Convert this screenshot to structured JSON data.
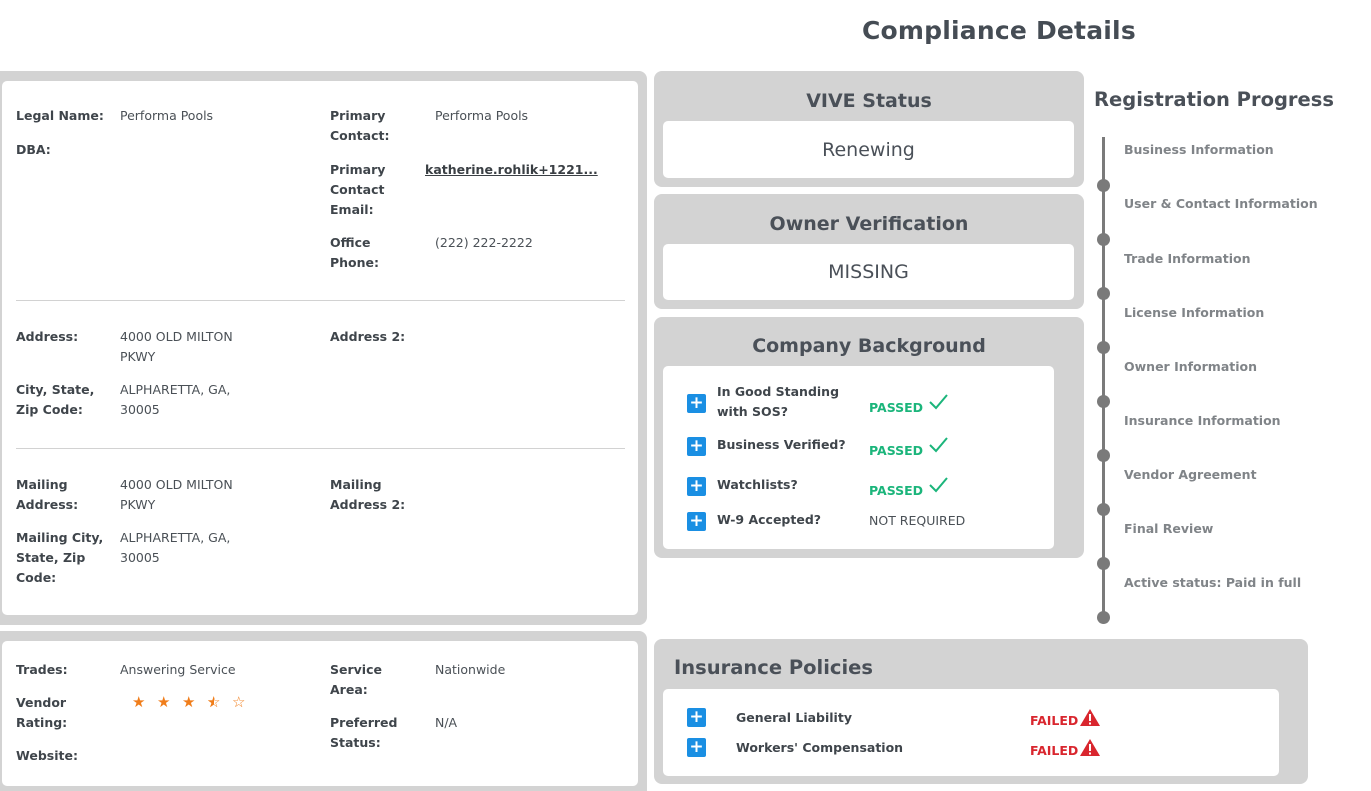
{
  "page_title": "Compliance Details",
  "company": {
    "legal_name_label": "Legal Name:",
    "legal_name": "Performa Pools",
    "dba_label": "DBA:",
    "dba": "",
    "primary_contact_label": "Primary Contact:",
    "primary_contact": "Performa Pools",
    "primary_email_label": "Primary Contact Email:",
    "primary_email": "katherine.rohlik+1221...",
    "office_phone_label": "Office Phone:",
    "office_phone": "(222) 222-2222",
    "address_label": "Address:",
    "address": "4000 OLD MILTON PKWY",
    "address2_label": "Address 2:",
    "address2": "",
    "city_label": "City, State, Zip Code:",
    "city": "ALPHARETTA, GA, 30005",
    "mailing_address_label": "Mailing Address:",
    "mailing_address": "4000 OLD MILTON PKWY",
    "mailing_address2_label": "Mailing Address 2:",
    "mailing_address2": "",
    "mailing_city_label": "Mailing City, State, Zip Code:",
    "mailing_city": "ALPHARETTA, GA, 30005"
  },
  "vendor": {
    "trades_label": "Trades:",
    "trades": "Answering Service",
    "service_area_label": "Service Area:",
    "service_area": "Nationwide",
    "rating_label": "Vendor Rating:",
    "rating": 3.5,
    "rating_max": 5,
    "preferred_label": "Preferred Status:",
    "preferred": "N/A",
    "website_label": "Website:",
    "website": ""
  },
  "vive_status": {
    "title": "VIVE Status",
    "value": "Renewing"
  },
  "owner_verification": {
    "title": "Owner Verification",
    "value": "MISSING"
  },
  "company_background": {
    "title": "Company Background",
    "items": [
      {
        "label": "In Good Standing with SOS?",
        "status": "PASSED"
      },
      {
        "label": "Business Verified?",
        "status": "PASSED"
      },
      {
        "label": "Watchlists?",
        "status": "PASSED"
      },
      {
        "label": "W-9 Accepted?",
        "status": "NOT REQUIRED"
      }
    ],
    "status_colors": {
      "passed": "#1bb57b",
      "not_required": "#4a5056"
    }
  },
  "registration_progress": {
    "title": "Registration Progress",
    "steps": [
      "Business Information",
      "User & Contact Information",
      "Trade Information",
      "License Information",
      "Owner Information",
      "Insurance Information",
      "Vendor Agreement",
      "Final Review",
      "Active status: Paid in full"
    ]
  },
  "insurance_policies": {
    "title": "Insurance Policies",
    "items": [
      {
        "label": "General Liability",
        "status": "FAILED"
      },
      {
        "label": "Workers' Compensation",
        "status": "FAILED"
      }
    ],
    "status_color": "#d9262e"
  },
  "colors": {
    "accent": "#1a8fe3",
    "panel": "#d3d3d3",
    "star": "#f07d1a"
  }
}
